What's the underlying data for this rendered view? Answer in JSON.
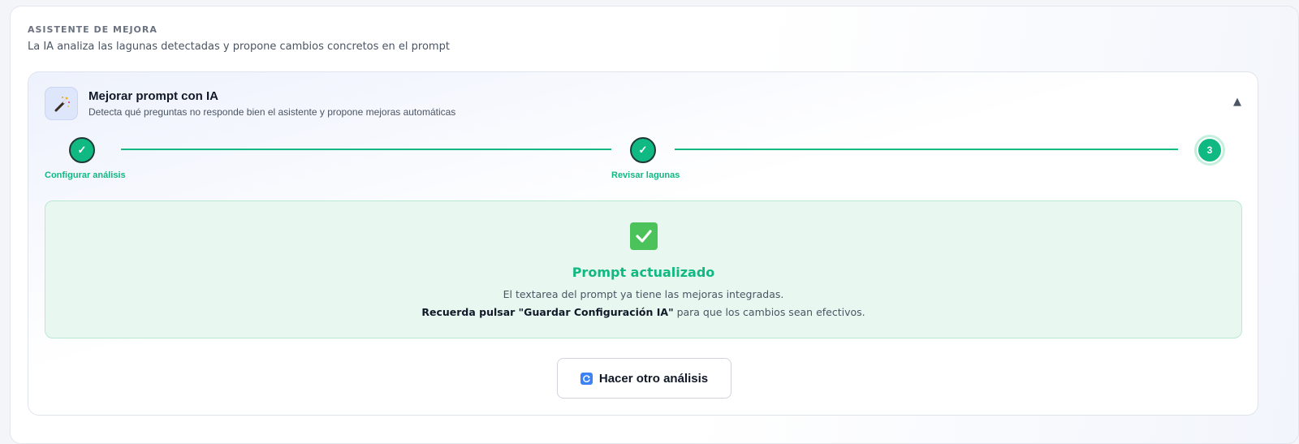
{
  "section": {
    "eyebrow": "ASISTENTE DE MEJORA",
    "description": "La IA analiza las lagunas detectadas y propone cambios concretos en el prompt"
  },
  "card": {
    "title": "Mejorar prompt con IA",
    "subtitle": "Detecta qué preguntas no responde bien el asistente y propone mejoras automáticas",
    "collapse_glyph": "▲",
    "icon": "magic-wand-icon"
  },
  "steps": [
    {
      "label": "Configurar análisis",
      "glyph": "✓",
      "state": "done"
    },
    {
      "label": "Revisar lagunas",
      "glyph": "✓",
      "state": "done"
    },
    {
      "label": "",
      "glyph": "3",
      "state": "current"
    }
  ],
  "result": {
    "icon": "check-box-icon",
    "title": "Prompt actualizado",
    "line1": "El textarea del prompt ya tiene las mejoras integradas.",
    "line2_bold": "Recuerda pulsar \"Guardar Configuración IA\"",
    "line2_rest": " para que los cambios sean efectivos."
  },
  "actions": {
    "again_label": "Hacer otro análisis",
    "again_icon": "refresh-icon"
  },
  "colors": {
    "accent_green": "#10b981",
    "success_bg": "#e8f8f1",
    "icon_bg": "#dde6fb"
  }
}
